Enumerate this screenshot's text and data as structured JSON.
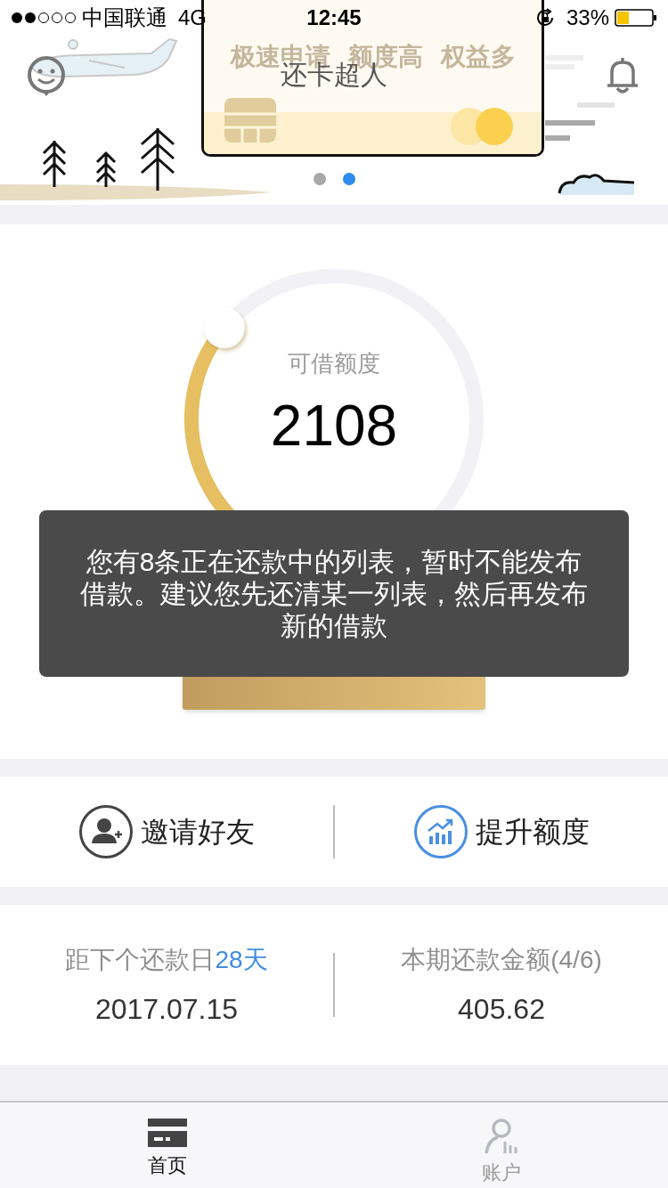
{
  "status_bar": {
    "carrier": "中国联通",
    "network": "4G",
    "time": "12:45",
    "battery": "33%"
  },
  "banner": {
    "title": "还卡超人",
    "card_tagline": [
      "极速申请",
      "额度高",
      "权益多"
    ],
    "dots": [
      {
        "selected": false
      },
      {
        "selected": true
      }
    ]
  },
  "credit": {
    "label": "可借额度",
    "amount": "2108"
  },
  "toast": {
    "message": "您有8条正在还款中的列表，暂时不能发布借款。建议您先还清某一列表，然后再发布新的借款"
  },
  "actions": [
    {
      "kind": "invite",
      "label": "邀请好友"
    },
    {
      "kind": "raise",
      "label": "提升额度"
    }
  ],
  "repayment": [
    {
      "label": "距下个还款日",
      "highlight": "28天",
      "value": "2017.07.15"
    },
    {
      "label": "本期还款金额(4/6)",
      "value": "405.62"
    }
  ],
  "tabs": [
    {
      "kind": "home",
      "label": "首页",
      "selected": true
    },
    {
      "kind": "account",
      "label": "账户",
      "selected": false
    }
  ]
}
